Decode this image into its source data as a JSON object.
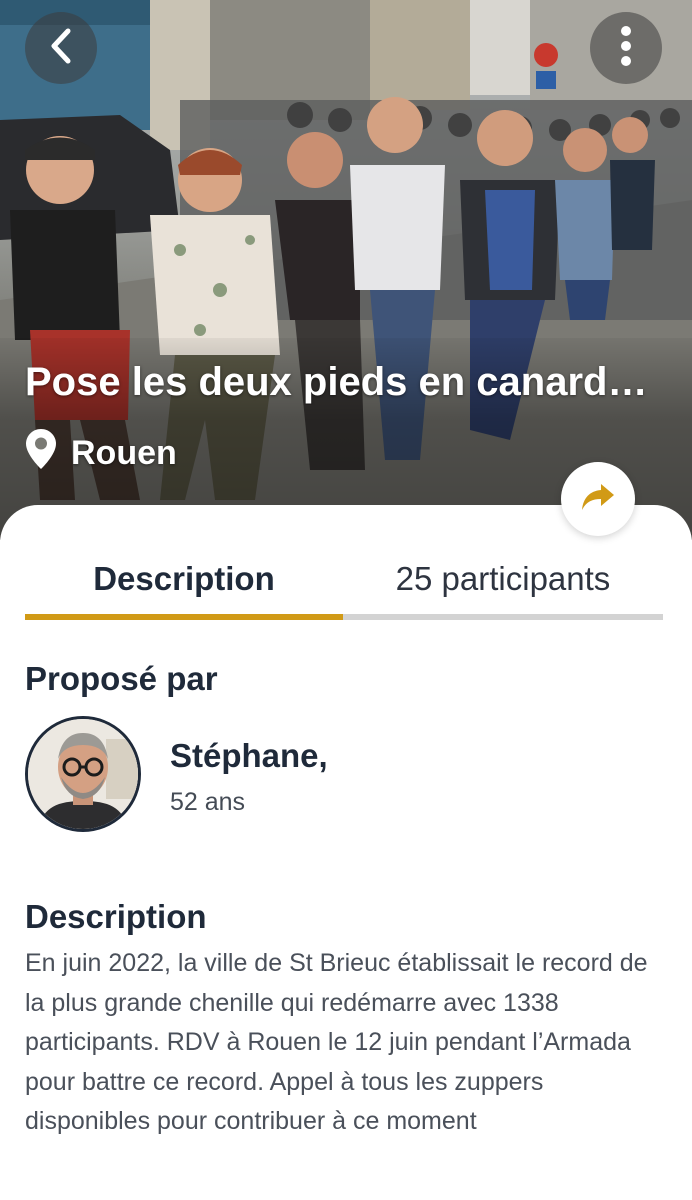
{
  "hero": {
    "title": "Pose les deux pieds en canard…",
    "location": "Rouen",
    "back_icon": "chevron-left-icon",
    "more_icon": "more-vertical-icon",
    "location_icon": "map-pin-icon"
  },
  "share": {
    "icon": "share-arrow-icon",
    "color": "#d19a16"
  },
  "tabs": [
    {
      "label": "Description",
      "active": true
    },
    {
      "label": "25 participants",
      "active": false
    }
  ],
  "colors": {
    "accent": "#d19a16",
    "text_dark": "#1f2a3a",
    "text_body": "#4a505a",
    "tab_track": "#d3d3d3"
  },
  "proposer": {
    "heading": "Proposé par",
    "name": "Stéphane,",
    "age": "52 ans"
  },
  "description": {
    "heading": "Description",
    "text": "En juin 2022, la ville de St Brieuc établissait le record de la plus grande chenille qui redémarre avec 1338 participants. RDV à Rouen le 12 juin pendant l’Armada pour battre ce record. Appel à tous les zuppers disponibles pour contribuer à ce moment"
  }
}
